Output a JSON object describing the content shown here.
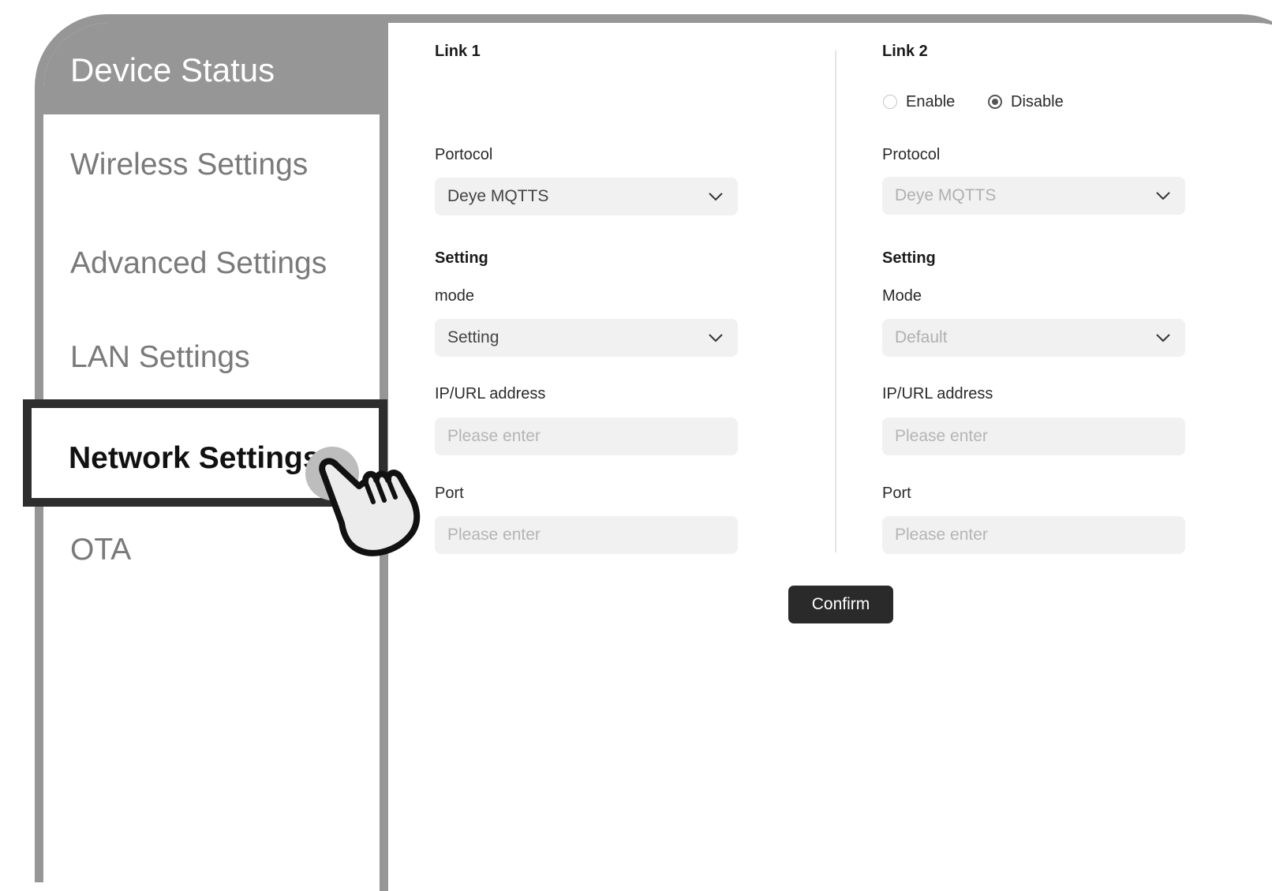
{
  "sidebar": {
    "header": "Device Status",
    "items": [
      {
        "label": "Wireless Settings"
      },
      {
        "label": "Advanced Settings"
      },
      {
        "label": "LAN Settings"
      },
      {
        "label": "Network Settings",
        "active": true
      },
      {
        "label": "OTA"
      }
    ]
  },
  "link1": {
    "title": "Link 1",
    "protocol_label": "Portocol",
    "protocol_value": "Deye MQTTS",
    "setting_heading": "Setting",
    "mode_label": "mode",
    "mode_value": "Setting",
    "ip_label": "IP/URL address",
    "ip_placeholder": "Please enter",
    "port_label": "Port",
    "port_placeholder": "Please enter"
  },
  "link2": {
    "title": "Link 2",
    "enable_label": "Enable",
    "disable_label": "Disable",
    "selected": "Disable",
    "protocol_label": "Protocol",
    "protocol_value": "Deye MQTTS",
    "setting_heading": "Setting",
    "mode_label": "Mode",
    "mode_value": "Default",
    "ip_label": "IP/URL address",
    "ip_placeholder": "Please enter",
    "port_label": "Port",
    "port_placeholder": "Please enter"
  },
  "actions": {
    "confirm_label": "Confirm"
  }
}
